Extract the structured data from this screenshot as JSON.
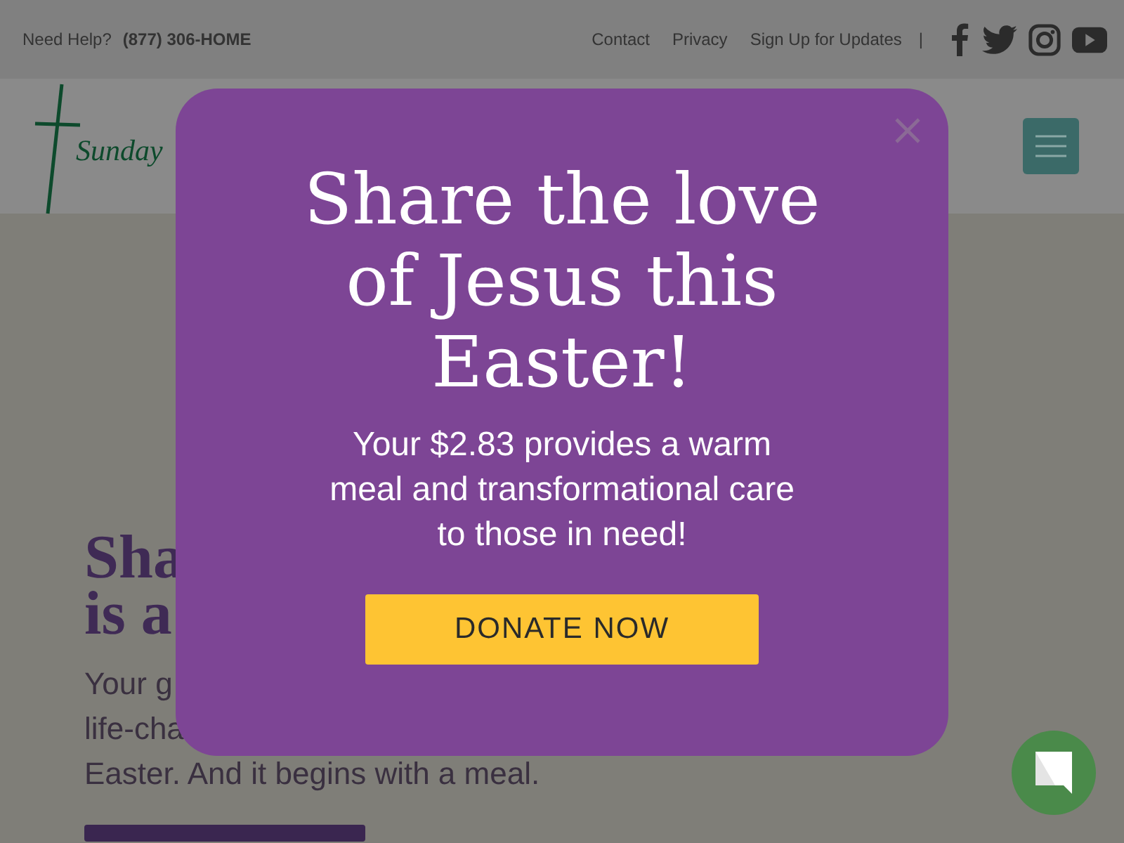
{
  "top_bar": {
    "help_label": "Need Help?",
    "phone": "(877) 306-HOME",
    "links": [
      {
        "label": "Contact"
      },
      {
        "label": "Privacy"
      },
      {
        "label": "Sign Up for Updates"
      }
    ],
    "separator": "|"
  },
  "header": {
    "logo_text": "Sunday"
  },
  "hero": {
    "heading_lines": [
      "Sha",
      "is a"
    ],
    "body_lines": [
      "Your g",
      "life-cha",
      "Easter. And it begins with a meal."
    ]
  },
  "modal": {
    "title": "Share the love of Jesus this Easter!",
    "text": "Your $2.83 provides a warm meal and transformational care to those in need!",
    "button": "DONATE NOW"
  }
}
